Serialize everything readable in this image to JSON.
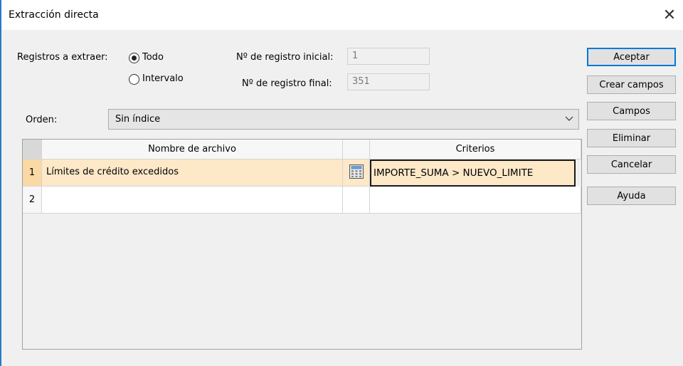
{
  "window": {
    "title": "Extracción directa",
    "close_symbol": "✕"
  },
  "records": {
    "label": "Registros a extraer:",
    "option_all": "Todo",
    "option_range": "Intervalo",
    "selected": "Todo",
    "start_label": "Nº de registro inicial:",
    "start_value": "1",
    "end_label": "Nº de registro final:",
    "end_value": "351"
  },
  "order": {
    "label": "Orden:",
    "value": "Sin índice"
  },
  "buttons": {
    "accept": "Aceptar",
    "create_fields": "Crear campos",
    "fields": "Campos",
    "delete": "Eliminar",
    "cancel": "Cancelar",
    "help": "Ayuda"
  },
  "grid": {
    "columns": {
      "filename": "Nombre de archivo",
      "criteria": "Criterios"
    },
    "rows": [
      {
        "num": "1",
        "filename": "Límites de crédito excedidos",
        "criteria": "IMPORTE_SUMA > NUEVO_LIMITE"
      },
      {
        "num": "2",
        "filename": "",
        "criteria": ""
      }
    ]
  },
  "colors": {
    "accent": "#0078d7",
    "selected_row": "#fde8c8",
    "row_number_selected": "#fbd9a4"
  }
}
